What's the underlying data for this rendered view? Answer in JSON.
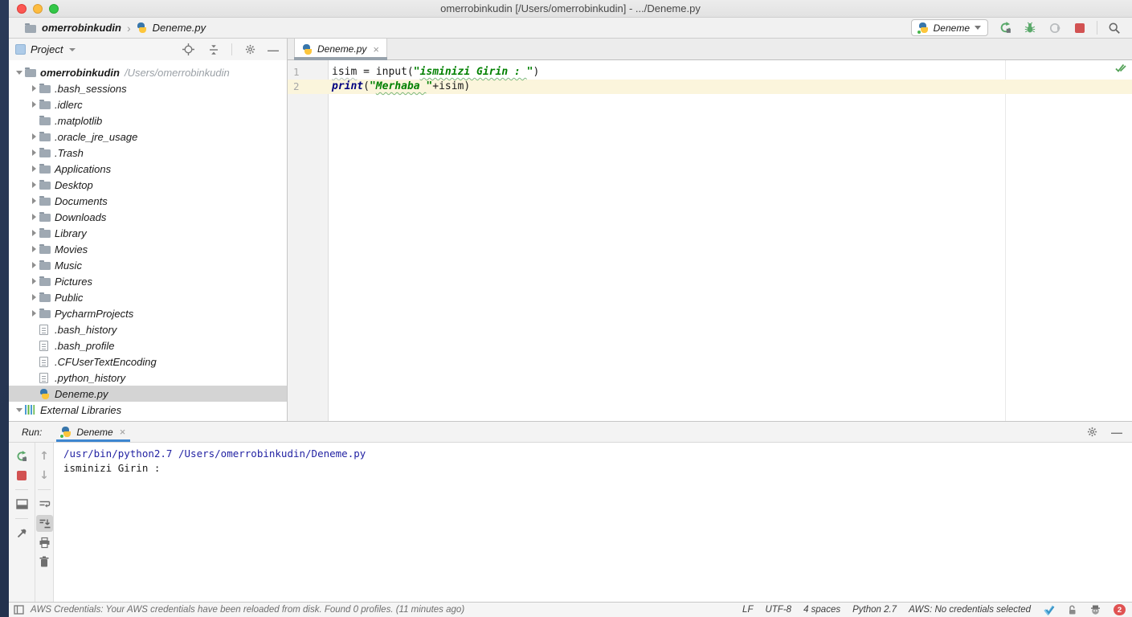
{
  "colors": {
    "accent_blue": "#3e86d0",
    "ide_green": "#59a869",
    "stop_red": "#d25252",
    "caret_line": "#fbf5dc",
    "string_green": "#008000",
    "keyword_navy": "#000080",
    "console_system_blue": "#2323a3",
    "selection_gray": "#d4d4d4"
  },
  "title_bar": {
    "title": "omerrobinkudin [/Users/omerrobinkudin] - .../Deneme.py"
  },
  "breadcrumb": {
    "project": "omerrobinkudin",
    "separator": "›",
    "file": "Deneme.py"
  },
  "run_controls": {
    "config_name": "Deneme",
    "icons": [
      "rerun-icon",
      "debug-bug-icon",
      "coverage-icon",
      "stop-icon",
      "search-everywhere-icon"
    ]
  },
  "project_panel": {
    "title": "Project",
    "header_icons": [
      "locate-icon",
      "collapse-all-icon",
      "settings-gear-icon",
      "hide-icon"
    ],
    "tree": [
      {
        "depth": 0,
        "arrow": "expanded",
        "icon": "folder-icon",
        "label": "omerrobinkudin",
        "label_class": "bold",
        "extra": "/Users/omerrobinkudin"
      },
      {
        "depth": 1,
        "arrow": "collapsed",
        "icon": "folder-icon",
        "label": ".bash_sessions"
      },
      {
        "depth": 1,
        "arrow": "collapsed",
        "icon": "folder-icon",
        "label": ".idlerc"
      },
      {
        "depth": 1,
        "arrow": "none",
        "icon": "folder-icon",
        "label": ".matplotlib"
      },
      {
        "depth": 1,
        "arrow": "collapsed",
        "icon": "folder-icon",
        "label": ".oracle_jre_usage"
      },
      {
        "depth": 1,
        "arrow": "collapsed",
        "icon": "folder-icon",
        "label": ".Trash"
      },
      {
        "depth": 1,
        "arrow": "collapsed",
        "icon": "folder-icon",
        "label": "Applications"
      },
      {
        "depth": 1,
        "arrow": "collapsed",
        "icon": "folder-icon",
        "label": "Desktop"
      },
      {
        "depth": 1,
        "arrow": "collapsed",
        "icon": "folder-icon",
        "label": "Documents"
      },
      {
        "depth": 1,
        "arrow": "collapsed",
        "icon": "folder-icon",
        "label": "Downloads"
      },
      {
        "depth": 1,
        "arrow": "collapsed",
        "icon": "folder-icon",
        "label": "Library"
      },
      {
        "depth": 1,
        "arrow": "collapsed",
        "icon": "folder-icon",
        "label": "Movies"
      },
      {
        "depth": 1,
        "arrow": "collapsed",
        "icon": "folder-icon",
        "label": "Music"
      },
      {
        "depth": 1,
        "arrow": "collapsed",
        "icon": "folder-icon",
        "label": "Pictures"
      },
      {
        "depth": 1,
        "arrow": "collapsed",
        "icon": "folder-icon",
        "label": "Public"
      },
      {
        "depth": 1,
        "arrow": "collapsed",
        "icon": "folder-icon",
        "label": "PycharmProjects"
      },
      {
        "depth": 1,
        "arrow": "none",
        "icon": "file-icon",
        "label": ".bash_history"
      },
      {
        "depth": 1,
        "arrow": "none",
        "icon": "file-icon",
        "label": ".bash_profile"
      },
      {
        "depth": 1,
        "arrow": "none",
        "icon": "file-icon",
        "label": ".CFUserTextEncoding"
      },
      {
        "depth": 1,
        "arrow": "none",
        "icon": "file-icon",
        "label": ".python_history"
      },
      {
        "depth": 1,
        "arrow": "none",
        "icon": "python-icon",
        "label": "Deneme.py",
        "state": "selected"
      },
      {
        "depth": 0,
        "arrow": "expanded",
        "icon": "library-icon",
        "label": "External Libraries"
      }
    ]
  },
  "editor": {
    "tab": {
      "label": "Deneme.py",
      "close": "×"
    },
    "inspection_icon": "inspections-ok-icon",
    "lines": [
      {
        "number": "1",
        "segments": [
          "isim",
          " = input(",
          "\"",
          "isminizi Girin : ",
          "\"",
          ")"
        ]
      },
      {
        "number": "2",
        "segments": [
          "print",
          "(",
          "\"",
          "Merhaba ",
          "\"",
          "+isim)"
        ]
      }
    ]
  },
  "run_panel": {
    "label": "Run:",
    "tab": {
      "label": "Deneme",
      "close": "×"
    },
    "left_toolbar_icons": [
      "rerun-icon",
      "stop-icon",
      "restore-layout-icon",
      "pin-icon"
    ],
    "console_toolbar_icons": [
      "up-stack-icon",
      "down-stack-icon",
      "soft-wrap-icon",
      "scroll-to-end-icon",
      "print-icon",
      "clear-all-icon"
    ],
    "console_lines": [
      {
        "text": "/usr/bin/python2.7 /Users/omerrobinkudin/Deneme.py",
        "kind": "sys"
      },
      {
        "text": "isminizi Girin :",
        "kind": "plain"
      }
    ]
  },
  "status_bar": {
    "message": "AWS Credentials: Your AWS credentials have been reloaded from disk. Found 0 profiles. (11 minutes ago)",
    "items": [
      {
        "text": "LF"
      },
      {
        "text": "UTF-8"
      },
      {
        "text": "4 spaces"
      },
      {
        "text": "Python 2.7"
      },
      {
        "text": "AWS: No credentials selected"
      }
    ],
    "right_icons": [
      "inspections-check-icon",
      "lock-icon",
      "hector-inspector-icon",
      "notifications-badge"
    ],
    "notification_count": "2"
  }
}
